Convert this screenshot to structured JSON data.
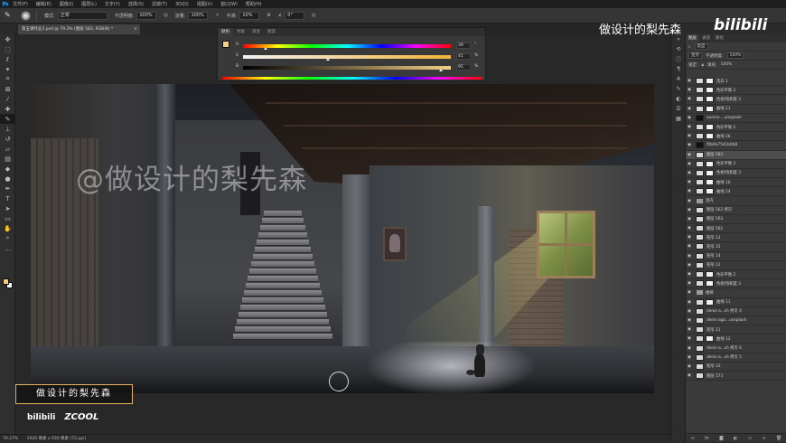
{
  "menu": {
    "logo": "Ps",
    "items": [
      "文件(F)",
      "编辑(E)",
      "图像(I)",
      "图层(L)",
      "文字(Y)",
      "选择(S)",
      "滤镜(T)",
      "3D(D)",
      "视图(V)",
      "窗口(W)",
      "帮助(H)"
    ]
  },
  "options": {
    "mode_label": "模式:",
    "mode_value": "正常",
    "opacity_label": "不透明度:",
    "opacity_value": "100%",
    "flow_label": "流量:",
    "flow_value": "100%",
    "smooth_label": "平滑:",
    "smooth_value": "10%",
    "angle_value": "0°"
  },
  "document": {
    "tab_title": "第五课作业2.psd @ 79.3% (图层 583, RGB/8) *",
    "close": "×"
  },
  "watermark_text": "@做设计的梨先森",
  "caption": "做设计的梨先森",
  "logos": {
    "bili": "bilibili",
    "zcool": "ZCOOL"
  },
  "brand": {
    "cn": "做设计的梨先森",
    "bili": "bilibili"
  },
  "color_panel": {
    "tabs": [
      "颜色",
      "色板",
      "渐变",
      "图案"
    ],
    "active_tab": 0,
    "foreground": "#f3cf86",
    "rows": [
      {
        "channel": "H",
        "value": "39",
        "unit": "°",
        "fraction": 0.108
      },
      {
        "channel": "S",
        "value": "41",
        "unit": "%",
        "fraction": 0.41
      },
      {
        "channel": "B",
        "value": "95",
        "unit": "%",
        "fraction": 0.95
      }
    ]
  },
  "layers_panel": {
    "tabs": [
      "图层",
      "通道",
      "路径"
    ],
    "active_tab": 0,
    "filter_label": "类型",
    "blend_mode": "变亮",
    "opacity_label": "不透明度:",
    "opacity_value": "100%",
    "lock_label": "锁定:",
    "fill_label": "填充:",
    "fill_value": "100%",
    "layers": [
      {
        "name": "黑白 1",
        "type": "adj"
      },
      {
        "name": "色彩平衡 2",
        "type": "adj"
      },
      {
        "name": "色相/饱和度 3",
        "type": "adj"
      },
      {
        "name": "曲线 21",
        "type": "adj"
      },
      {
        "name": "aurora-...unsplash",
        "type": "dark"
      },
      {
        "name": "色彩平衡 2",
        "type": "adj"
      },
      {
        "name": "曲线 26",
        "type": "adj"
      },
      {
        "name": "f0b9a7541b0b8",
        "type": "dark"
      },
      {
        "name": "图层 583",
        "type": "pixel",
        "selected": true
      },
      {
        "name": "色彩平衡 2",
        "type": "adj"
      },
      {
        "name": "色相/饱和度 3",
        "type": "adj"
      },
      {
        "name": "曲线 16",
        "type": "adj"
      },
      {
        "name": "曲线 24",
        "type": "adj"
      },
      {
        "name": "室内",
        "type": "group"
      },
      {
        "name": "图层 562 拷贝",
        "type": "pixel"
      },
      {
        "name": "图层 563",
        "type": "pixel"
      },
      {
        "name": "图层 562",
        "type": "pixel"
      },
      {
        "name": "矩形 13",
        "type": "pixel"
      },
      {
        "name": "矩形 15",
        "type": "pixel"
      },
      {
        "name": "矩形 14",
        "type": "pixel"
      },
      {
        "name": "矩形 12",
        "type": "pixel"
      },
      {
        "name": "色彩平衡 2",
        "type": "adj"
      },
      {
        "name": "色相/饱和度 3",
        "type": "adj"
      },
      {
        "name": "楼梯",
        "type": "group"
      },
      {
        "name": "曲线 11",
        "type": "adj"
      },
      {
        "name": "denis-a...sh 拷贝 4",
        "type": "pixel"
      },
      {
        "name": "denis-ago...unsplash",
        "type": "pixel"
      },
      {
        "name": "矩形 11",
        "type": "pixel"
      },
      {
        "name": "曲线 12",
        "type": "adj"
      },
      {
        "name": "denis-a...sh 拷贝 6",
        "type": "pixel"
      },
      {
        "name": "denis-a...sh 拷贝 5",
        "type": "pixel"
      },
      {
        "name": "矩形 10",
        "type": "pixel"
      },
      {
        "name": "图层 573",
        "type": "pixel"
      }
    ]
  },
  "status": {
    "zoom": "79.27%",
    "info": "1920 像素 x 930 像素 (72 ppi)"
  }
}
